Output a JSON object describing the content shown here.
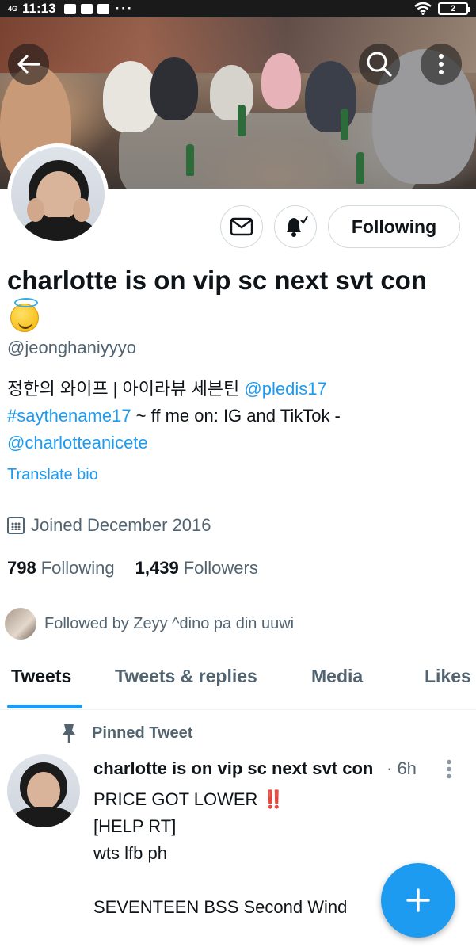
{
  "status_bar": {
    "network": "4G",
    "time": "11:13",
    "dots": "···",
    "battery": "2"
  },
  "header": {
    "back_icon": "arrow-left-icon",
    "search_icon": "search-icon",
    "more_icon": "more-vertical-icon"
  },
  "profile": {
    "display_name": "charlotte is on vip sc next svt con",
    "emoji": "smiling-face-with-halo",
    "handle": "@jeonghaniyyyo",
    "bio_text_1": "정한의 와이프 | 아이라뷰 세븐틴 ",
    "bio_link_1": "@pledis17",
    "bio_link_2": "#saythename17",
    "bio_text_2": " ~ ff me on: IG and TikTok - ",
    "bio_link_3": "@charlotteanicete",
    "translate_label": "Translate bio",
    "joined": "Joined December 2016",
    "following_count": "798",
    "following_label": "Following",
    "followers_count": "1,439",
    "followers_label": "Followers",
    "followed_by": "Followed by Zeyy ^dino pa din uuwi"
  },
  "actions": {
    "message_icon": "envelope-icon",
    "notify_icon": "bell-icon",
    "follow_label": "Following"
  },
  "tabs": [
    {
      "label": "Tweets",
      "active": true
    },
    {
      "label": "Tweets & replies",
      "active": false
    },
    {
      "label": "Media",
      "active": false
    },
    {
      "label": "Likes",
      "active": false
    }
  ],
  "tweet": {
    "pinned_label": "Pinned Tweet",
    "author": "charlotte is on vip sc next svt con",
    "time": "· 6h",
    "line_1": "PRICE GOT LOWER ",
    "line_1_emoji": "‼️",
    "body_rest": "\n[HELP RT]\nwts lfb ph\n\nSEVENTEEN BSS Second Wind"
  },
  "fab": {
    "icon": "plus-icon"
  },
  "colors": {
    "accent": "#1d9bf0",
    "text": "#0f1419",
    "muted": "#536471"
  }
}
